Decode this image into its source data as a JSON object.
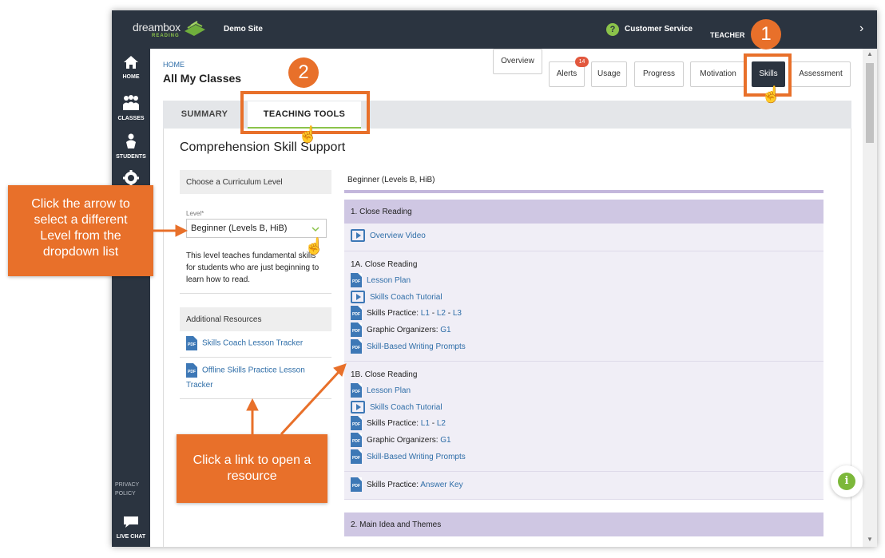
{
  "topbar": {
    "logo_word": "dreambox",
    "logo_sub": "READING",
    "site": "Demo Site",
    "customer_service": "Customer Service",
    "role": "TEACHER",
    "help_glyph": "?",
    "chevron": "›"
  },
  "sidebar": {
    "items": [
      {
        "label": "HOME",
        "icon": "home-icon"
      },
      {
        "label": "CLASSES",
        "icon": "classes-icon"
      },
      {
        "label": "STUDENTS",
        "icon": "students-icon"
      },
      {
        "label": "",
        "icon": "settings-icon"
      }
    ],
    "privacy_line1": "PRIVACY",
    "privacy_line2": "POLICY",
    "live_chat": "LIVE CHAT"
  },
  "header": {
    "breadcrumb": "HOME",
    "title": "All My Classes"
  },
  "top_tabs": [
    {
      "label": "Overview"
    },
    {
      "label": "Alerts",
      "badge": "14"
    },
    {
      "label": "Usage"
    },
    {
      "label": "Progress"
    },
    {
      "label": "Motivation"
    },
    {
      "label": "Skills",
      "active": true
    },
    {
      "label": "Assessment"
    }
  ],
  "sub_tabs": [
    {
      "label": "SUMMARY"
    },
    {
      "label": "TEACHING TOOLS",
      "active": true
    }
  ],
  "panel": {
    "title": "Comprehension Skill Support",
    "curriculum_head": "Choose a Curriculum Level",
    "level_label": "Level*",
    "level_value": "Beginner (Levels B, HiB)",
    "level_desc": "This level teaches fundamental skills for students who are just beginning to learn how to read.",
    "additional_head": "Additional Resources",
    "resources": [
      "Skills Coach Lesson Tracker",
      "Offline Skills Practice Lesson Tracker"
    ],
    "pdf_glyph": "PDF"
  },
  "curriculum": {
    "level_heading": "Beginner (Levels B, HiB)",
    "section1": {
      "title": "1. Close Reading",
      "overview": "Overview Video"
    },
    "sub1a": {
      "title": "1A. Close Reading",
      "lesson_plan": "Lesson Plan",
      "coach_tutorial": "Skills Coach Tutorial",
      "practice_label": "Skills Practice:",
      "practice_links": [
        "L1",
        "L2",
        "L3"
      ],
      "organizers_label": "Graphic Organizers:",
      "organizer_link": "G1",
      "writing_prompts": "Skill-Based Writing Prompts"
    },
    "sub1b": {
      "title": "1B. Close Reading",
      "lesson_plan": "Lesson Plan",
      "coach_tutorial": "Skills Coach Tutorial",
      "practice_label": "Skills Practice:",
      "practice_links": [
        "L1",
        "L2"
      ],
      "organizers_label": "Graphic Organizers:",
      "organizer_link": "G1",
      "writing_prompts": "Skill-Based Writing Prompts"
    },
    "answer_key_label": "Skills Practice:",
    "answer_key_link": "Answer Key",
    "dash": "-",
    "section2": {
      "title": "2. Main Idea and Themes"
    }
  },
  "annotations": {
    "callout_level": "Click the arrow to select a different Level from the dropdown list",
    "callout_link": "Click a link to open a resource",
    "step1": "1",
    "step2": "2"
  },
  "info_glyph": "i",
  "colors": {
    "accent_orange": "#e8702a",
    "nav_dark": "#2b3440",
    "brand_green": "#8bc34a",
    "link_blue": "#2f6ea8",
    "section_lavender": "#cfc7e3"
  }
}
